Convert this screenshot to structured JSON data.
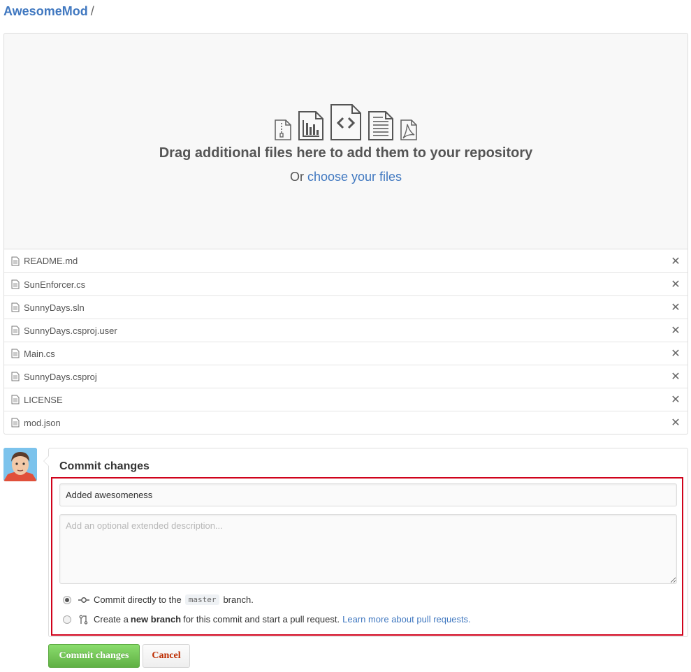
{
  "breadcrumb": {
    "repo": "AwesomeMod",
    "separator": "/"
  },
  "dropzone": {
    "heading": "Drag additional files here to add them to your repository",
    "sub_prefix": "Or",
    "sub_link": "choose your files",
    "icons": [
      "zip-file-icon",
      "chart-file-icon",
      "code-file-icon",
      "text-file-icon",
      "pdf-file-icon"
    ]
  },
  "files": [
    {
      "name": "README.md"
    },
    {
      "name": "SunEnforcer.cs"
    },
    {
      "name": "SunnyDays.sln"
    },
    {
      "name": "SunnyDays.csproj.user"
    },
    {
      "name": "Main.cs"
    },
    {
      "name": "SunnyDays.csproj"
    },
    {
      "name": "LICENSE"
    },
    {
      "name": "mod.json"
    }
  ],
  "commit": {
    "title": "Commit changes",
    "summary_value": "Added awesomeness",
    "description_placeholder": "Add an optional extended description...",
    "option_direct": {
      "prefix": "Commit directly to the",
      "branch": "master",
      "suffix": "branch.",
      "checked": true
    },
    "option_new_branch": {
      "prefix": "Create a",
      "bold": "new branch",
      "suffix": "for this commit and start a pull request.",
      "link": "Learn more about pull requests.",
      "checked": false
    }
  },
  "buttons": {
    "commit": "Commit changes",
    "cancel": "Cancel"
  },
  "colors": {
    "link": "#4078c0",
    "primary_button": "#60b044",
    "cancel_text": "#bd2c00",
    "highlight_border": "#d0021b"
  }
}
